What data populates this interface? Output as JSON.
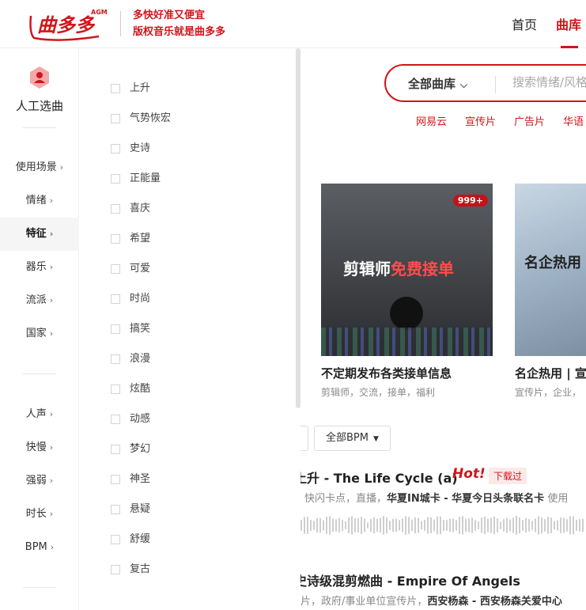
{
  "header": {
    "logo_text": "曲多多",
    "logo_badge": "AGM",
    "slogan_line1": "多快好准又便宜",
    "slogan_line2": "版权音乐就是曲多多",
    "nav": [
      {
        "label": "首页",
        "active": false
      },
      {
        "label": "曲库",
        "active": true
      }
    ]
  },
  "rail": {
    "title": "人工选曲",
    "group1": [
      {
        "label": "使用场景",
        "active": false
      },
      {
        "label": "情绪",
        "active": false
      },
      {
        "label": "特征",
        "active": true
      },
      {
        "label": "器乐",
        "active": false
      },
      {
        "label": "流派",
        "active": false
      },
      {
        "label": "国家",
        "active": false
      }
    ],
    "group2": [
      {
        "label": "人声"
      },
      {
        "label": "快慢"
      },
      {
        "label": "强弱"
      },
      {
        "label": "时长"
      },
      {
        "label": "BPM"
      }
    ]
  },
  "panel": {
    "tags": [
      "上升",
      "气势恢宏",
      "史诗",
      "正能量",
      "喜庆",
      "希望",
      "可爱",
      "时尚",
      "搞笑",
      "浪漫",
      "炫酷",
      "动感",
      "梦幻",
      "神圣",
      "悬疑",
      "舒缓",
      "复古"
    ]
  },
  "search": {
    "category": "全部曲库",
    "placeholder": "搜索情绪/风格",
    "hot_words": [
      "网易云",
      "宣传片",
      "广告片",
      "华语"
    ]
  },
  "cards": [
    {
      "title": "不定期发布各类接单信息",
      "sub": "剪辑师，交流，接单，福利",
      "overlay_a": "剪辑师",
      "overlay_b": "免费接单",
      "badge": "999+"
    },
    {
      "title": "名企热用 | 宣",
      "sub": "宣传片，企业，",
      "overlay": "名企热用"
    }
  ],
  "filters": {
    "bpm": "全部BPM"
  },
  "songs": [
    {
      "title": "上升 - The Life Cycle (a)",
      "hot_label": "Hot!",
      "status": "下载过",
      "meta_plain": "快闪卡点，直播，",
      "meta_bold": "华夏IN城卡 - 华夏今日头条联名卡",
      "meta_tail": "使用"
    },
    {
      "title": "史诗级混剪燃曲 - Empire Of Angels",
      "meta_plain": "片，政府/事业单位宣传片，",
      "meta_bold": "西安杨森 - 西安杨森关爱中心"
    }
  ],
  "colors": {
    "brand": "#d0161b",
    "rail_active_bg": "#f5f5f5"
  }
}
